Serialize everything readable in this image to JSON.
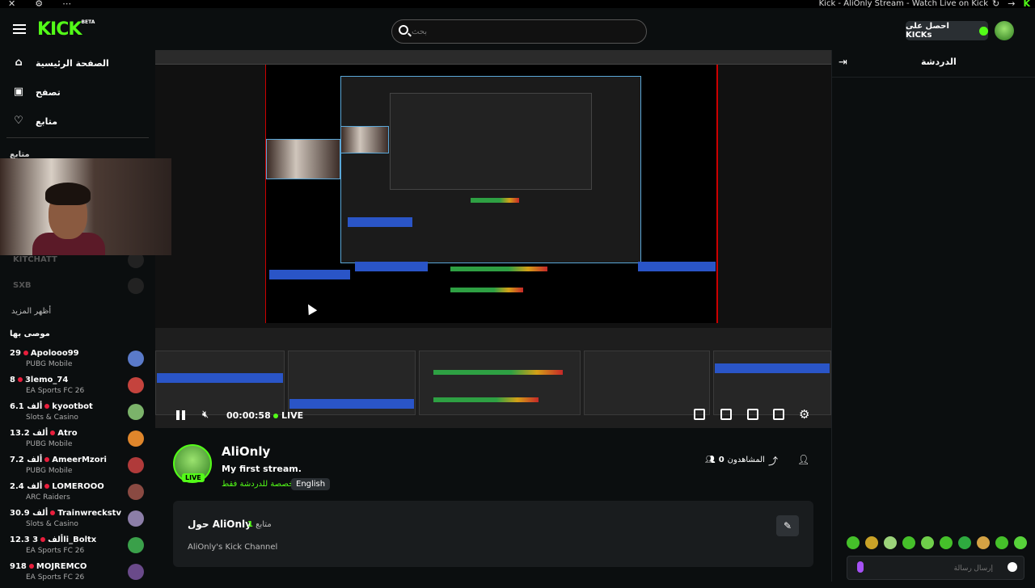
{
  "titlebar": {
    "title": "Kick - AliOnly Stream - Watch Live on Kick",
    "left_icons": [
      "close-icon",
      "extensions-icon",
      "more-icon"
    ],
    "right_icons": [
      "reload-icon",
      "forward-icon",
      "kick-favicon"
    ]
  },
  "header": {
    "logo": "KICK",
    "logo_badge": "BETA",
    "search_placeholder": "بحث",
    "kicks_button": "احصل على KICKs"
  },
  "sidebar": {
    "nav": [
      {
        "label": "الصفحة الرئيسية",
        "icon": "home-icon"
      },
      {
        "label": "تصفح",
        "icon": "browse-icon"
      },
      {
        "label": "متابع",
        "icon": "heart-icon"
      }
    ],
    "following_label": "متابع",
    "faded_channels": [
      "KITCHATT",
      "SXB"
    ],
    "show_more": "أظهر المزيد",
    "recommended_label": "موصى بها",
    "recommended": [
      {
        "viewers": "29",
        "name": "Apolooo99",
        "category": "PUBG Mobile",
        "color": "#5a7ac9"
      },
      {
        "viewers": "8",
        "name": "3lemo_74",
        "category": "EA Sports FC 26",
        "color": "#c4433d"
      },
      {
        "viewers": "6.1 ألف",
        "name": "kyootbot",
        "category": "Slots & Casino",
        "color": "#7bb36a"
      },
      {
        "viewers": "13.2 ألف",
        "name": "Atro",
        "category": "PUBG Mobile",
        "color": "#e0862b"
      },
      {
        "viewers": "7.2 ألف",
        "name": "AmeerMzori",
        "category": "PUBG Mobile",
        "color": "#b03a3a"
      },
      {
        "viewers": "2.4 ألف",
        "name": "LOMEROOO",
        "category": "ARC Raiders",
        "color": "#8a4a42"
      },
      {
        "viewers": "30.9 ألف",
        "name": "Trainwreckstv",
        "category": "Slots & Casino",
        "color": "#8c7ea8"
      },
      {
        "viewers": "12.3 ألف",
        "name": "3li_Boltx",
        "category": "EA Sports FC 26",
        "color": "#3aa04a"
      },
      {
        "viewers": "918",
        "name": "MOJREMCO",
        "category": "EA Sports FC 26",
        "color": "#6a4a8a"
      }
    ]
  },
  "player": {
    "time": "00:00:58",
    "live_label": "LIVE",
    "controls": [
      "pause-icon",
      "mute-icon",
      "pip-icon",
      "theater-icon",
      "clip-icon",
      "fullscreen-icon",
      "settings-icon"
    ]
  },
  "channel": {
    "name": "AliOnly",
    "live_badge": "LIVE",
    "title": "My first stream.",
    "tag_green": "مخصصة للدردشة فقط",
    "tag_language": "English",
    "viewers_label": "المشاهدون",
    "viewers_count": "0"
  },
  "about": {
    "title": "حول AliOnly",
    "followers_count": "1",
    "followers_label": "متابع",
    "description": "AliOnly's Kick Channel"
  },
  "chat": {
    "title": "الدردشة",
    "input_placeholder": "إرسال رسالة"
  }
}
